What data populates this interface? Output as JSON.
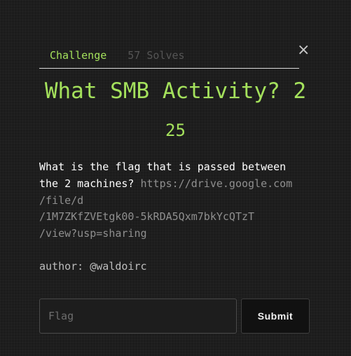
{
  "tabs": [
    {
      "label": "Challenge",
      "active": true
    },
    {
      "label": "57 Solves",
      "active": false
    }
  ],
  "close_icon": "×",
  "challenge": {
    "title": "What SMB Activity? 2",
    "points": "25",
    "description_prefix": "What is the flag that is passed between",
    "description_prefix2": "the 2 machines?",
    "link_lines": [
      "https://drive.google.com",
      "/file/d",
      "/1M7ZKfZVEtgk00-5kRDA5Qxm7bkYcQTzT",
      "/view?usp=sharing"
    ],
    "author": "author: @waldoirc"
  },
  "form": {
    "flag_placeholder": "Flag",
    "flag_value": "",
    "submit_label": "Submit"
  },
  "colors": {
    "accent": "#a4e15c",
    "background": "#1c1c1c"
  }
}
